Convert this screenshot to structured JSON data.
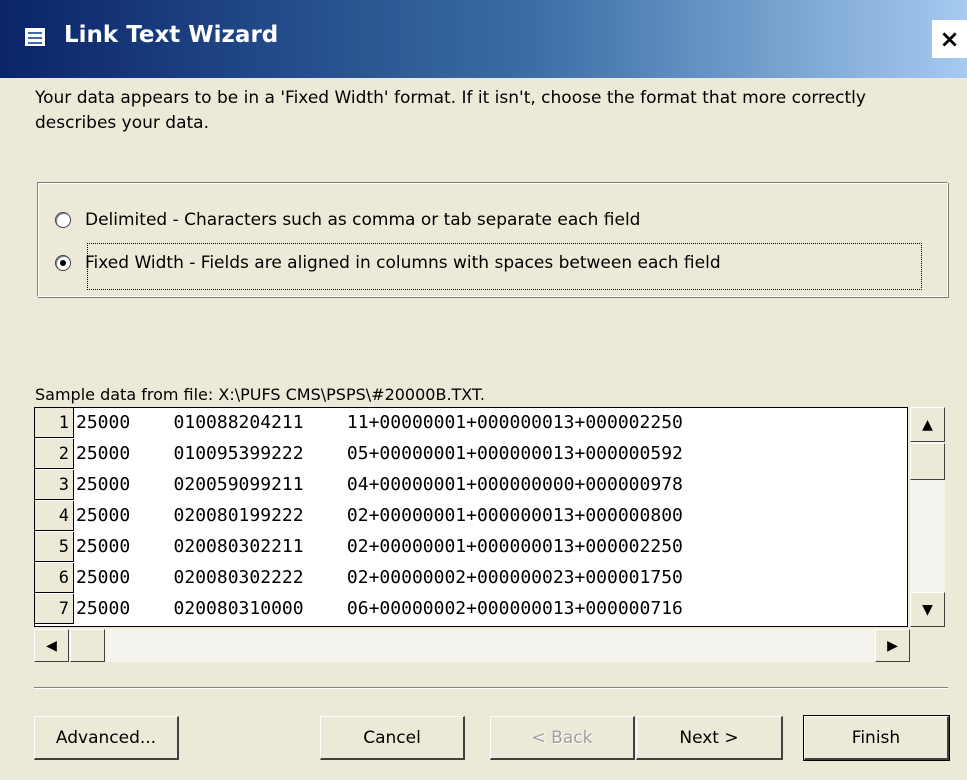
{
  "window": {
    "title": "Link Text Wizard",
    "close_symbol": "×"
  },
  "intro_text": "Your data appears to be in a 'Fixed Width' format. If it isn't, choose the format that more correctly describes your data.",
  "format_options": [
    {
      "label": "Delimited - Characters such as comma or tab separate each field",
      "selected": false
    },
    {
      "label": "Fixed Width - Fields are aligned in columns with spaces between each field",
      "selected": true
    }
  ],
  "sample": {
    "label": "Sample data from file: X:\\PUFS CMS\\PSPS\\#20000B.TXT.",
    "rows": [
      {
        "num": "1",
        "text": "25000    010088204211    11+00000001+000000013+000002250"
      },
      {
        "num": "2",
        "text": "25000    010095399222    05+00000001+000000013+000000592"
      },
      {
        "num": "3",
        "text": "25000    020059099211    04+00000001+000000000+000000978"
      },
      {
        "num": "4",
        "text": "25000    020080199222    02+00000001+000000013+000000800"
      },
      {
        "num": "5",
        "text": "25000    020080302211    02+00000001+000000013+000002250"
      },
      {
        "num": "6",
        "text": "25000    020080302222    02+00000002+000000023+000001750"
      },
      {
        "num": "7",
        "text": "25000    020080310000    06+00000002+000000013+000000716"
      }
    ]
  },
  "scroll": {
    "up": "▲",
    "down": "▼",
    "left": "◀",
    "right": "▶"
  },
  "buttons": {
    "advanced": "Advanced...",
    "cancel": "Cancel",
    "back": "< Back",
    "next": "Next >",
    "finish": "Finish"
  },
  "colors": {
    "titlebar_start": "#0a246a",
    "titlebar_end": "#a6caf0",
    "face": "#ece9d8"
  }
}
